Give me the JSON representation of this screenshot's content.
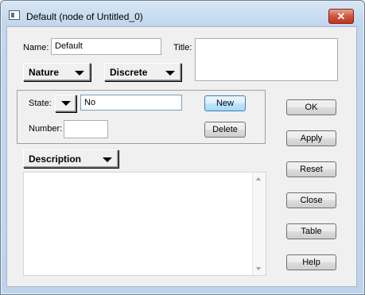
{
  "window": {
    "title": "Default (node of Untitled_0)",
    "close_glyph": "✕"
  },
  "form": {
    "name_label": "Name:",
    "name_value": "Default",
    "title_label": "Title:",
    "title_value": "",
    "nature_label": "Nature",
    "discrete_label": "Discrete",
    "state_label": "State:",
    "state_value": "No",
    "number_label": "Number:",
    "number_value": "",
    "new_button": "New",
    "delete_button": "Delete",
    "description_label": "Description",
    "description_value": ""
  },
  "buttons": {
    "ok": "OK",
    "apply": "Apply",
    "reset": "Reset",
    "close": "Close",
    "table": "Table",
    "help": "Help"
  },
  "icons": {
    "window_icon": "window-icon",
    "close_icon": "close-icon",
    "dropdown_icon": "triangle-down-icon"
  },
  "colors": {
    "close_button": "#c0361d",
    "focused_button_border": "#3c7fb1",
    "title_bar": "#c2d7ee"
  }
}
